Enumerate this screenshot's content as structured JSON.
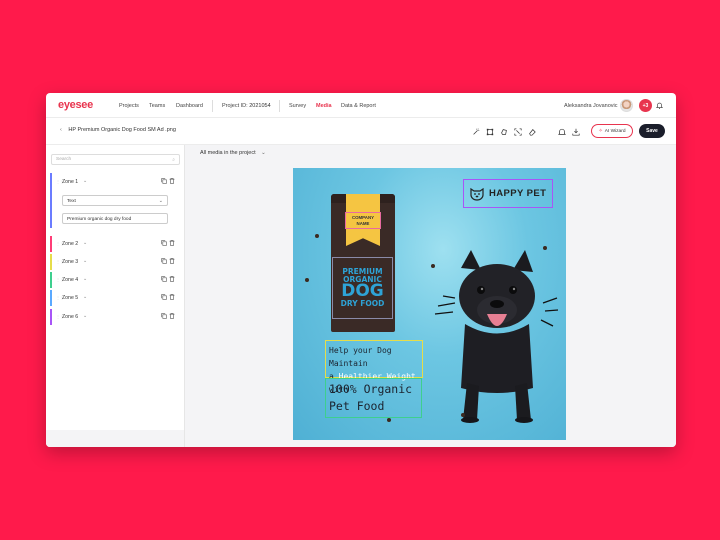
{
  "app": {
    "logo": "eyesee",
    "nav": [
      "Projects",
      "Teams",
      "Dashboard"
    ],
    "project_id_label": "Project ID:",
    "project_id": "2021054",
    "tabs": [
      "Survey",
      "Media",
      "Data & Report"
    ],
    "active_tab": "Media",
    "user_name": "Aleksandra Jovanovic",
    "extra_users": "+3"
  },
  "toolbar": {
    "file_title": "HP Premium Organic Dog Food SM Ad .png",
    "ai_wizard_label": "AI Wizard",
    "save_label": "Save"
  },
  "sidebar": {
    "search_placeholder": "Search",
    "zones": [
      {
        "label": "Zone 1",
        "color": "#6b7cff",
        "expanded": true
      },
      {
        "label": "Zone 2",
        "color": "#ff3d77"
      },
      {
        "label": "Zone 3",
        "color": "#e6dd4a"
      },
      {
        "label": "Zone 4",
        "color": "#3ecf8e"
      },
      {
        "label": "Zone 5",
        "color": "#5aa9ff"
      },
      {
        "label": "Zone 6",
        "color": "#a855f7"
      }
    ],
    "zone1_type": "Text",
    "zone1_value": "Premium organic dog dry food"
  },
  "main": {
    "media_filter": "All media in the project"
  },
  "ad": {
    "company_line1": "COMPANY",
    "company_line2": "NAME",
    "bag_line1": "PREMIUM",
    "bag_line2": "ORGANIC",
    "bag_line3": "DOG",
    "bag_line4": "DRY FOOD",
    "brand": "HAPPY PET",
    "tagline1_a": "Help your Dog Maintain",
    "tagline1_b": "a ",
    "tagline1_hl": "Healthier Weight",
    "tagline1_c": " with",
    "tagline2_a": "100% Organic",
    "tagline2_b": "Pet Food"
  },
  "colors": {
    "background": "#ff1a4b",
    "accent": "#e8344e",
    "save_button": "#1b1e2b"
  }
}
